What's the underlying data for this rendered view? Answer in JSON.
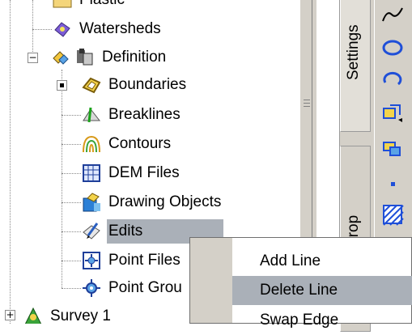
{
  "tree": {
    "items": [
      {
        "label": "Plastic"
      },
      {
        "label": "Watersheds"
      },
      {
        "label": "Definition"
      },
      {
        "label": "Boundaries"
      },
      {
        "label": "Breaklines"
      },
      {
        "label": "Contours"
      },
      {
        "label": "DEM Files"
      },
      {
        "label": "Drawing Objects"
      },
      {
        "label": "Edits"
      },
      {
        "label": "Point Files"
      },
      {
        "label": "Point Grou"
      },
      {
        "label": "Survey  1"
      }
    ],
    "expander_definition": "−",
    "expander_survey": "+"
  },
  "tabs": {
    "settings": "Settings",
    "second": "Prop"
  },
  "context_menu": {
    "items": [
      {
        "label": "Add Line"
      },
      {
        "label": "Delete Line"
      },
      {
        "label": "Swap Edge"
      }
    ]
  },
  "colors": {
    "selection": "#aab0b8",
    "chrome": "#d4d0c8",
    "toolbar_icon_blue": "#1f4fd8",
    "toolbar_icon_yellow": "#f3d34a"
  },
  "icons": [
    "folder-icon",
    "watersheds-icon",
    "definition-icon",
    "boundaries-icon",
    "breaklines-icon",
    "contours-icon",
    "dem-files-icon",
    "drawing-objects-icon",
    "edits-icon",
    "point-files-icon",
    "point-groups-icon",
    "survey-icon"
  ]
}
